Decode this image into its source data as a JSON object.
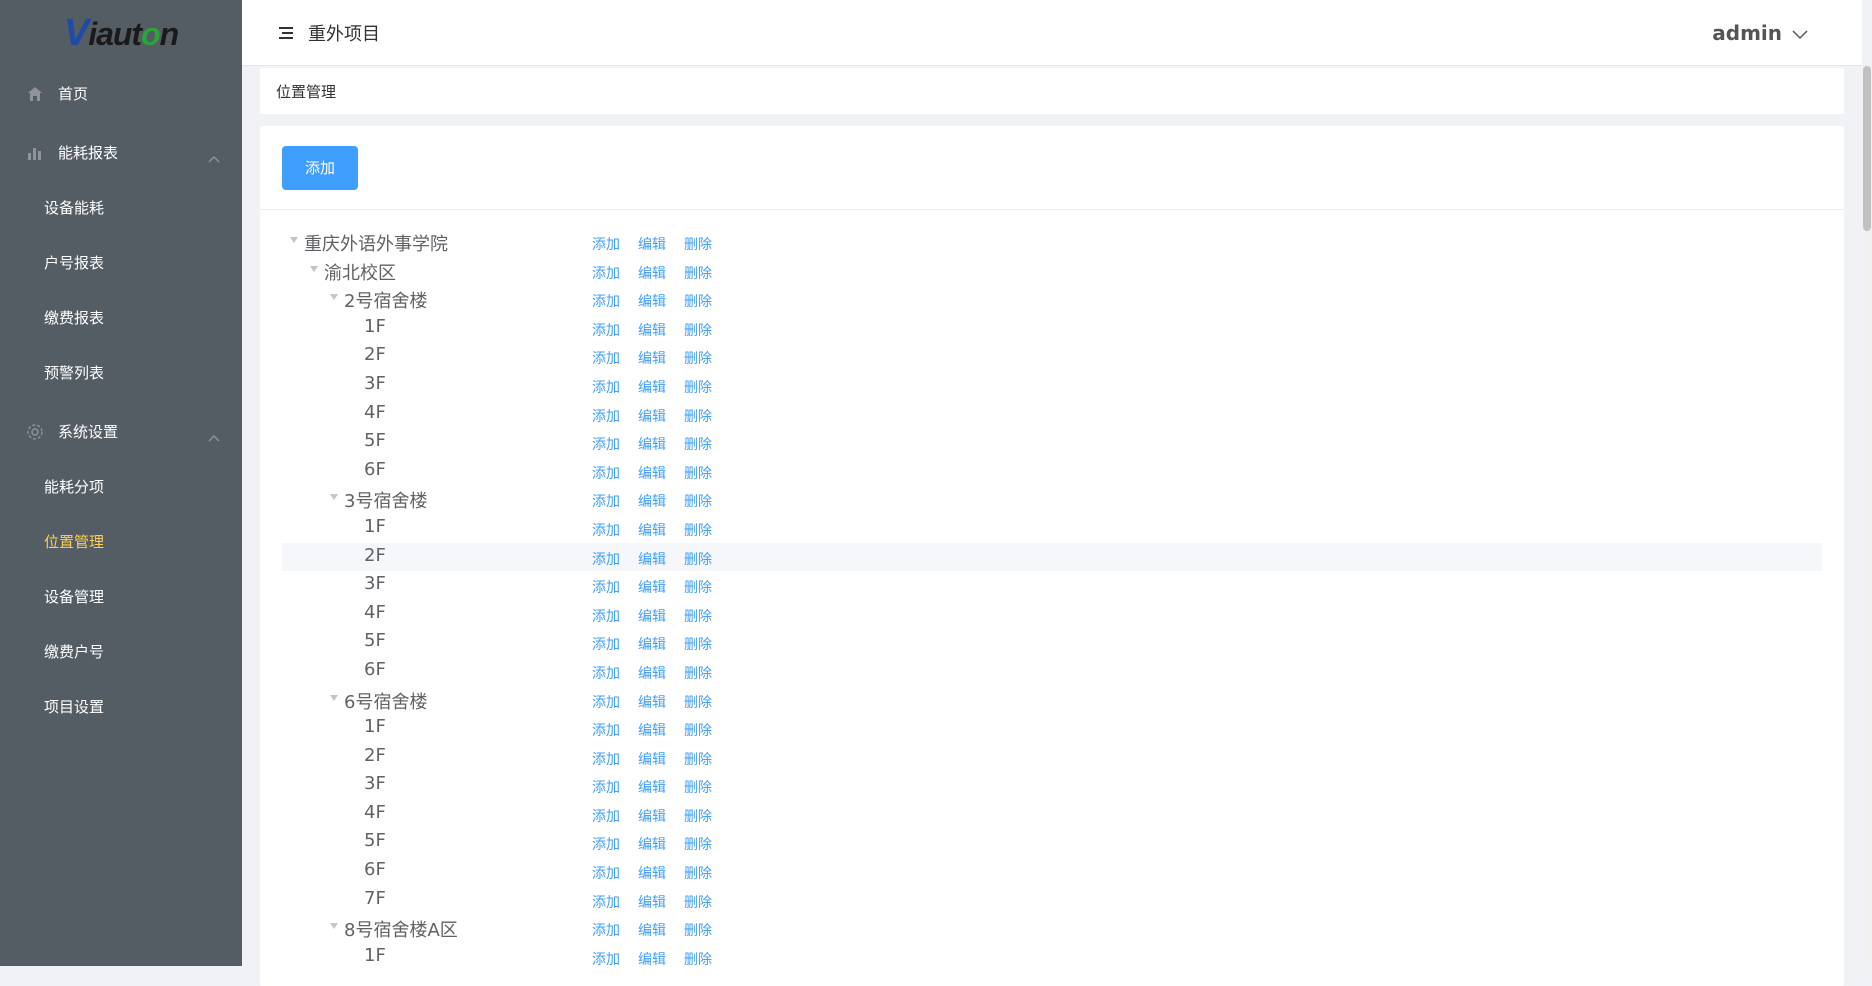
{
  "app": {
    "logo_letters": [
      "V",
      "iaut",
      "o",
      "n"
    ],
    "header_title": "重外项目",
    "user": "admin"
  },
  "sidebar": {
    "items": [
      {
        "label": "首页",
        "icon": "home-icon"
      },
      {
        "label": "能耗报表",
        "icon": "bar-chart-icon"
      },
      {
        "label": "设备能耗"
      },
      {
        "label": "户号报表"
      },
      {
        "label": "缴费报表"
      },
      {
        "label": "预警列表"
      },
      {
        "label": "系统设置",
        "icon": "gear-icon"
      },
      {
        "label": "能耗分项"
      },
      {
        "label": "位置管理",
        "active": true
      },
      {
        "label": "设备管理"
      },
      {
        "label": "缴费户号"
      },
      {
        "label": "项目设置"
      }
    ]
  },
  "breadcrumb": "位置管理",
  "toolbar": {
    "add_label": "添加"
  },
  "ops": {
    "add": "添加",
    "edit": "编辑",
    "delete": "删除"
  },
  "tree": [
    {
      "label": "重庆外语外事学院",
      "level": 0,
      "expandable": true
    },
    {
      "label": "渝北校区",
      "level": 1,
      "expandable": true
    },
    {
      "label": "2号宿舍楼",
      "level": 2,
      "expandable": true
    },
    {
      "label": "1F",
      "level": 3
    },
    {
      "label": "2F",
      "level": 3
    },
    {
      "label": "3F",
      "level": 3
    },
    {
      "label": "4F",
      "level": 3
    },
    {
      "label": "5F",
      "level": 3
    },
    {
      "label": "6F",
      "level": 3
    },
    {
      "label": "3号宿舍楼",
      "level": 2,
      "expandable": true
    },
    {
      "label": "1F",
      "level": 3
    },
    {
      "label": "2F",
      "level": 3,
      "highlighted": true
    },
    {
      "label": "3F",
      "level": 3
    },
    {
      "label": "4F",
      "level": 3
    },
    {
      "label": "5F",
      "level": 3
    },
    {
      "label": "6F",
      "level": 3
    },
    {
      "label": "6号宿舍楼",
      "level": 2,
      "expandable": true
    },
    {
      "label": "1F",
      "level": 3
    },
    {
      "label": "2F",
      "level": 3
    },
    {
      "label": "3F",
      "level": 3
    },
    {
      "label": "4F",
      "level": 3
    },
    {
      "label": "5F",
      "level": 3
    },
    {
      "label": "6F",
      "level": 3
    },
    {
      "label": "7F",
      "level": 3
    },
    {
      "label": "8号宿舍楼A区",
      "level": 2,
      "expandable": true
    },
    {
      "label": "1F",
      "level": 3
    }
  ],
  "colors": {
    "sidebar_bg": "#545c64",
    "active_menu": "#ffd04b",
    "primary": "#409eff",
    "highlight_row": "#f5f7fa"
  }
}
